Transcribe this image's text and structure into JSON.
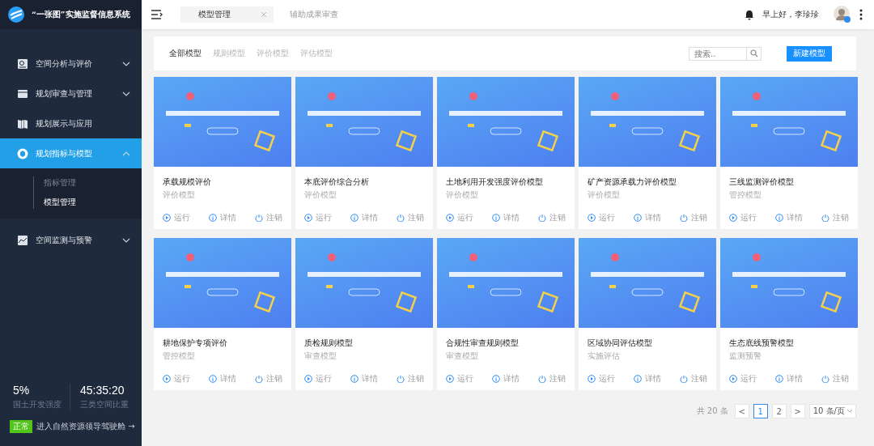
{
  "app": {
    "title": "“一张图”实施监督信息系统"
  },
  "sidebar": {
    "items": [
      {
        "label": "空间分析与评价",
        "expanded": false,
        "selected": false
      },
      {
        "label": "规划审查与管理",
        "expanded": false,
        "selected": false
      },
      {
        "label": "规划展示与应用",
        "selected": false
      },
      {
        "label": "规划指标与模型",
        "expanded": true,
        "selected": true,
        "children": [
          {
            "label": "指标管理",
            "selected": false
          },
          {
            "label": "模型管理",
            "selected": true
          }
        ]
      },
      {
        "label": "空间监测与预警",
        "expanded": false,
        "selected": false
      }
    ],
    "stats": [
      {
        "value": "5%",
        "label": "国土开发强度"
      },
      {
        "value": "45:35:20",
        "label": "三类空间比重"
      }
    ],
    "status_badge": "正常",
    "link": "进入自然资源领导驾驶舱 →"
  },
  "topbar": {
    "tabs": [
      {
        "label": "模型管理",
        "selected": true
      },
      {
        "label": "辅助成果审查",
        "selected": false
      }
    ],
    "greeting": "早上好，李珍珍"
  },
  "filters": [
    {
      "label": "全部模型",
      "selected": true
    },
    {
      "label": "规则模型",
      "selected": false
    },
    {
      "label": "评价模型",
      "selected": false
    },
    {
      "label": "评估模型",
      "selected": false
    }
  ],
  "search": {
    "placeholder": "搜索.."
  },
  "new_button": "新建模型",
  "cards": [
    {
      "title": "承载规模评价",
      "type": "评价模型",
      "actions": [
        {
          "kind": "run",
          "label": "运行"
        },
        {
          "kind": "info",
          "label": "详情"
        },
        {
          "kind": "power",
          "label": "注销"
        }
      ]
    },
    {
      "title": "本底评价综合分析",
      "type": "评价模型",
      "actions": [
        {
          "kind": "run",
          "label": "运行"
        },
        {
          "kind": "info",
          "label": "详情"
        },
        {
          "kind": "power",
          "label": "注销"
        }
      ]
    },
    {
      "title": "土地利用开发强度评价模型",
      "type": "评价模型",
      "actions": [
        {
          "kind": "run",
          "label": "运行"
        },
        {
          "kind": "info",
          "label": "详情"
        },
        {
          "kind": "power",
          "label": "注销"
        }
      ]
    },
    {
      "title": "矿产资源承载力评价模型",
      "type": "评价模型",
      "actions": [
        {
          "kind": "run",
          "label": "运行"
        },
        {
          "kind": "info",
          "label": "详情"
        },
        {
          "kind": "power",
          "label": "注销"
        }
      ]
    },
    {
      "title": "三线监测评价模型",
      "type": "管控模型",
      "actions": [
        {
          "kind": "run",
          "label": "运行"
        },
        {
          "kind": "info",
          "label": "详情"
        },
        {
          "kind": "power",
          "label": "注销"
        }
      ]
    },
    {
      "title": "耕地保护专项评价",
      "type": "管控模型",
      "actions": [
        {
          "kind": "run",
          "label": "运行"
        },
        {
          "kind": "info",
          "label": "详情"
        },
        {
          "kind": "power",
          "label": "注销"
        }
      ]
    },
    {
      "title": "质检规则模型",
      "type": "审查模型",
      "actions": [
        {
          "kind": "run",
          "label": "运行"
        },
        {
          "kind": "info",
          "label": "详情"
        },
        {
          "kind": "power",
          "label": "注销"
        }
      ]
    },
    {
      "title": "合规性审查规则模型",
      "type": "审查模型",
      "actions": [
        {
          "kind": "run",
          "label": "运行"
        },
        {
          "kind": "info",
          "label": "详情"
        },
        {
          "kind": "power",
          "label": "注销"
        }
      ]
    },
    {
      "title": "区域协同评估模型",
      "type": "实施评估",
      "actions": [
        {
          "kind": "run",
          "label": "运行"
        },
        {
          "kind": "info",
          "label": "详情"
        },
        {
          "kind": "power",
          "label": "注销"
        }
      ]
    },
    {
      "title": "生态底线预警模型",
      "type": "监测预警",
      "actions": [
        {
          "kind": "run",
          "label": "运行"
        },
        {
          "kind": "info",
          "label": "详情"
        },
        {
          "kind": "power",
          "label": "注销"
        }
      ]
    }
  ],
  "pagination": {
    "total": "共 20 条",
    "prev": "<",
    "next": ">",
    "pages": [
      {
        "label": "1",
        "selected": true
      },
      {
        "label": "2",
        "selected": false
      }
    ],
    "page_size": "10 条/页"
  }
}
